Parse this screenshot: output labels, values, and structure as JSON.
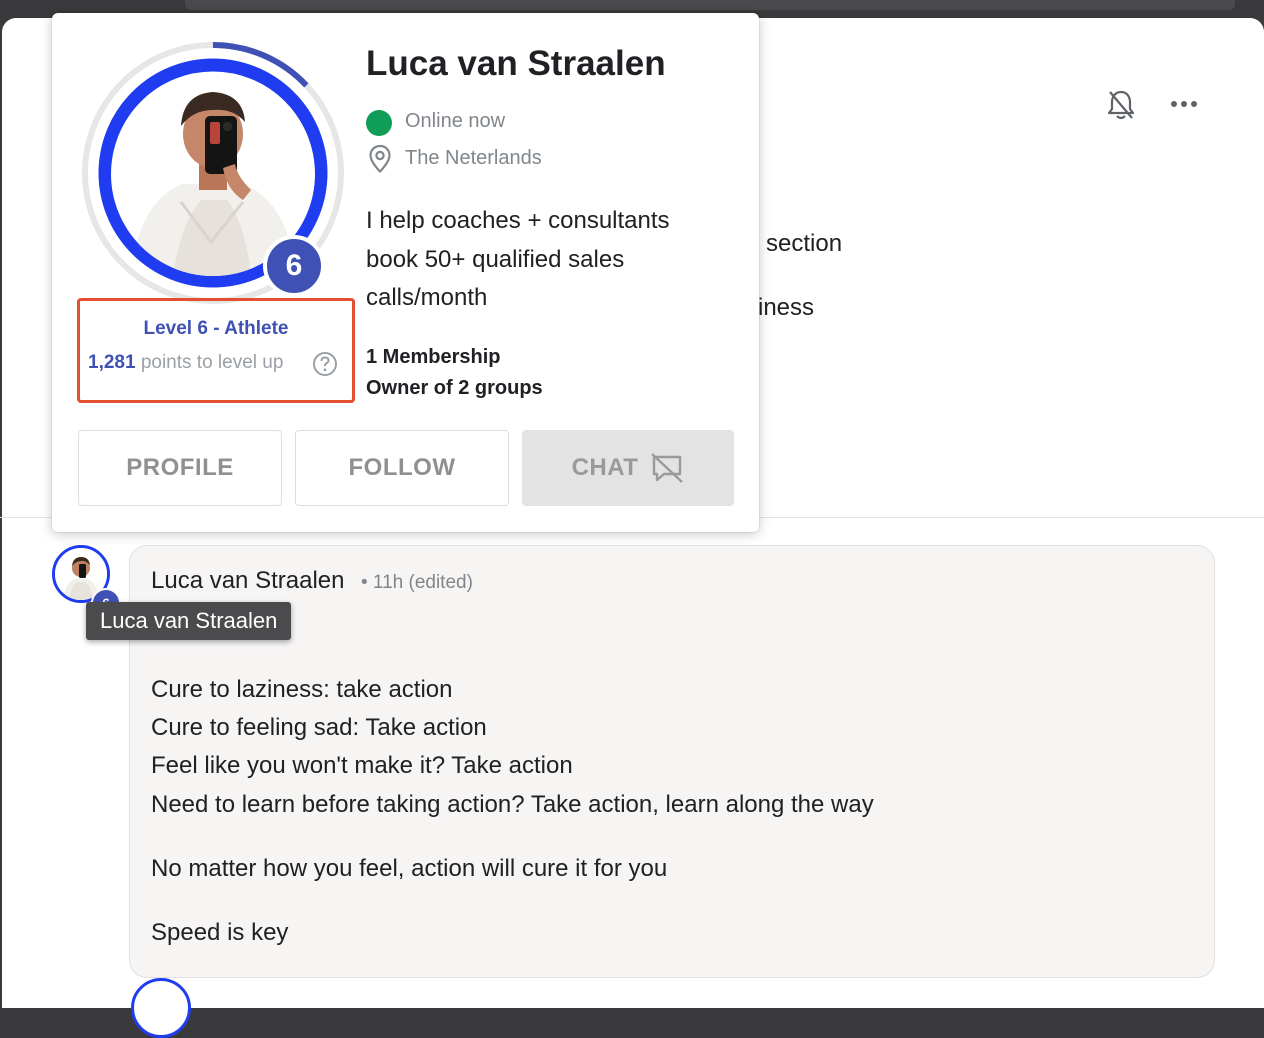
{
  "profile_card": {
    "name": "Luca van Straalen",
    "status": "Online now",
    "location": "The Neterlands",
    "bio": "I help coaches + consultants book 50+ qualified sales calls/month",
    "level_badge": "6",
    "level_title": "Level 6 - Athlete",
    "points_value": "1,281",
    "points_suffix": "points to level up",
    "level_progress": 0.13,
    "memberships": "1 Membership",
    "owner_of": "Owner of 2 groups",
    "buttons": {
      "profile": "PROFILE",
      "follow": "FOLLOW",
      "chat": "CHAT"
    },
    "icons": [
      "location-pin-icon",
      "help-circle-icon",
      "chat-disabled-icon"
    ]
  },
  "header": {
    "icons": [
      "bell-off-icon",
      "more-horizontal-icon"
    ]
  },
  "background_text": [
    "section",
    "iness"
  ],
  "post": {
    "author": "Luca van Straalen",
    "meta": "• 11h (edited)",
    "avatar_badge": "6",
    "tooltip": "Luca van Straalen",
    "lines": [
      "Cure to laziness: take action",
      "Cure to feeling sad: Take action",
      "Feel like you won't make it? Take action",
      "Need to learn before taking action? Take action, learn along the way",
      "No matter how you feel, action will cure it for you",
      "Speed is key"
    ]
  },
  "colors": {
    "accent": "#3f51b5",
    "ring": "#1f3cf0",
    "online": "#0f9d58",
    "highlight_border": "#e4502f"
  }
}
